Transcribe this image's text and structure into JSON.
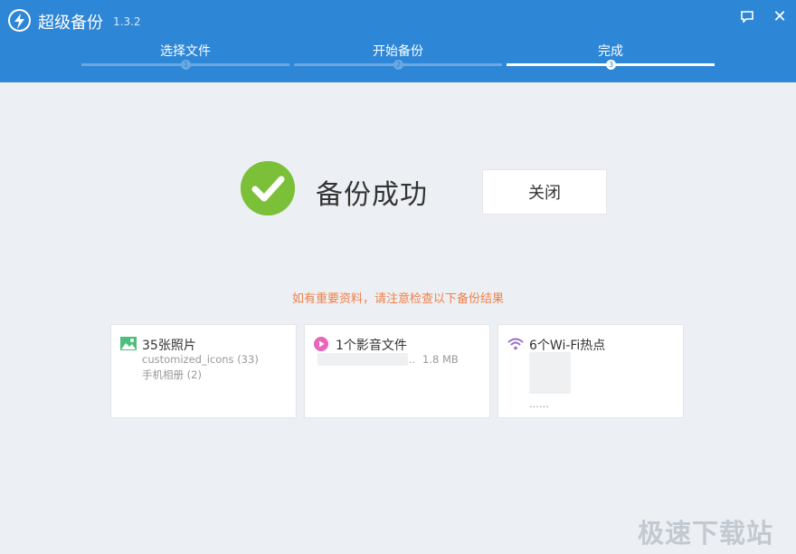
{
  "app": {
    "title": "超级备份",
    "version": "1.3.2"
  },
  "steps": [
    {
      "label": "选择文件",
      "number": "1"
    },
    {
      "label": "开始备份",
      "number": "2"
    },
    {
      "label": "完成",
      "number": "3"
    }
  ],
  "window_controls": {
    "close_glyph": "✕"
  },
  "result": {
    "message": "备份成功",
    "close_label": "关闭",
    "notice": "如有重要资料，请注意检查以下备份结果"
  },
  "cards": {
    "photos": {
      "title": "35张照片",
      "lines": [
        "customized_icons (33)",
        "手机相册 (2)"
      ]
    },
    "media": {
      "title": "1个影音文件",
      "ellipsis": "..",
      "size": "1.8 MB"
    },
    "wifi": {
      "title": "6个Wi-Fi热点",
      "ellipsis": "......"
    }
  },
  "watermark": "极速下载站",
  "colors": {
    "header": "#2e86d6",
    "success": "#7cc03a",
    "notice": "#f0804a",
    "photo_icon": "#4cbf7c",
    "media_icon": "#e865b8",
    "wifi_icon": "#9b6cc9"
  }
}
